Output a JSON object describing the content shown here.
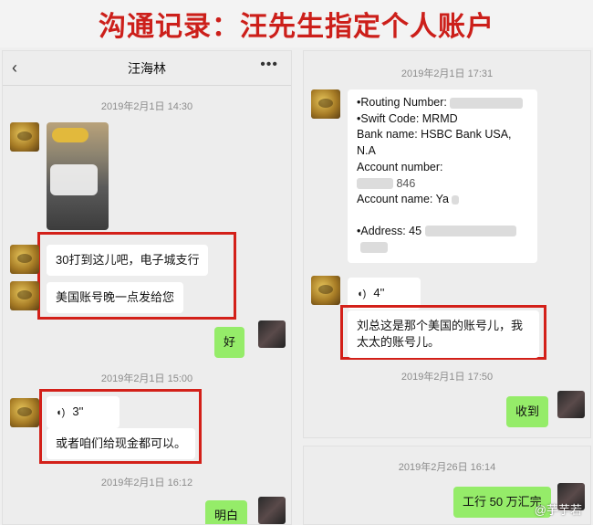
{
  "banner": {
    "title": "沟通记录：汪先生指定个人账户"
  },
  "left": {
    "header": {
      "title": "汪海林",
      "back": "‹",
      "more": "•••"
    },
    "ts1": "2019年2月1日 14:30",
    "msg_30": "30打到这儿吧，电子城支行",
    "msg_usa": "美国账号晚一点发给您",
    "reply_ok": "好",
    "ts2": "2019年2月1日 15:00",
    "voice_len": "3''",
    "msg_cash": "或者咱们给现金都可以。",
    "ts3": "2019年2月1日 16:12",
    "reply_understood": "明白"
  },
  "right": {
    "ts1": "2019年2月1日 17:31",
    "card": {
      "routing": "•Routing Number:",
      "swift": "•Swift Code: MRMD",
      "bank": "Bank name:  HSBC Bank USA,",
      "bank2": "N.A",
      "account_label": "Account number:",
      "account_tail": "846",
      "account_name": "Account name: Ya",
      "address": "•Address: 45"
    },
    "voice_len": "4''",
    "msg_wife": "刘总这是那个美国的账号儿，我太太的账号儿。",
    "ts2": "2019年2月1日 17:50",
    "reply_received": "收到"
  },
  "right_bottom": {
    "ts": "2019年2月26日 16:14",
    "msg_bank": "工行 50 万汇完"
  },
  "watermark": "@芋芋若"
}
